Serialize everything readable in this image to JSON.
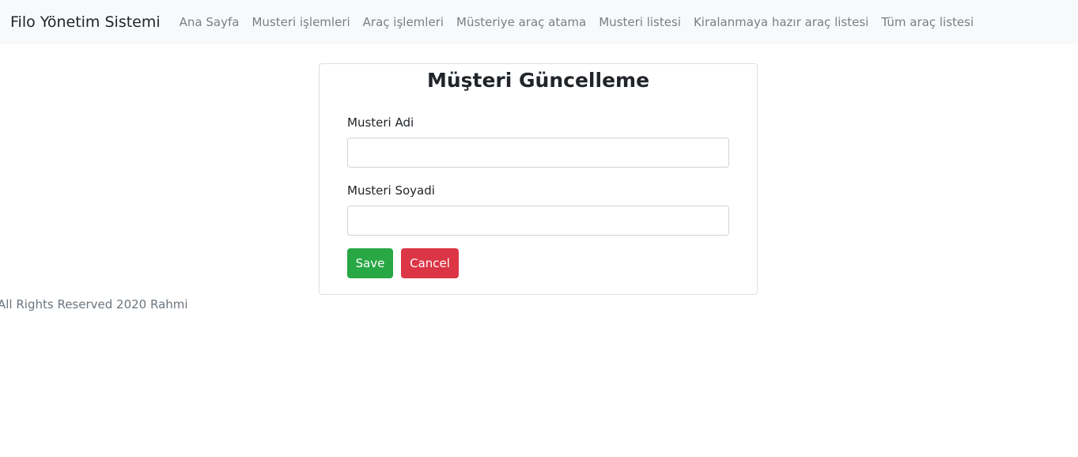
{
  "navbar": {
    "brand": "Filo Yönetim Sistemi",
    "links": [
      {
        "label": "Ana Sayfa"
      },
      {
        "label": "Musteri işlemleri"
      },
      {
        "label": "Araç işlemleri"
      },
      {
        "label": "Müsteriye araç atama"
      },
      {
        "label": "Musteri listesi"
      },
      {
        "label": "Kiralanmaya hazır araç listesi"
      },
      {
        "label": "Tüm araç listesi"
      }
    ]
  },
  "form": {
    "title": "Müşteri Güncelleme",
    "first_name": {
      "label": "Musteri Adi",
      "value": ""
    },
    "last_name": {
      "label": "Musteri Soyadi",
      "value": ""
    },
    "save_label": "Save",
    "cancel_label": "Cancel"
  },
  "footer": {
    "text": "All Rights Reserved 2020 Rahmi"
  },
  "colors": {
    "navbar_bg": "#f8f9fa",
    "save": "#28a745",
    "cancel": "#dc3545",
    "muted_text": "#6c757d"
  }
}
